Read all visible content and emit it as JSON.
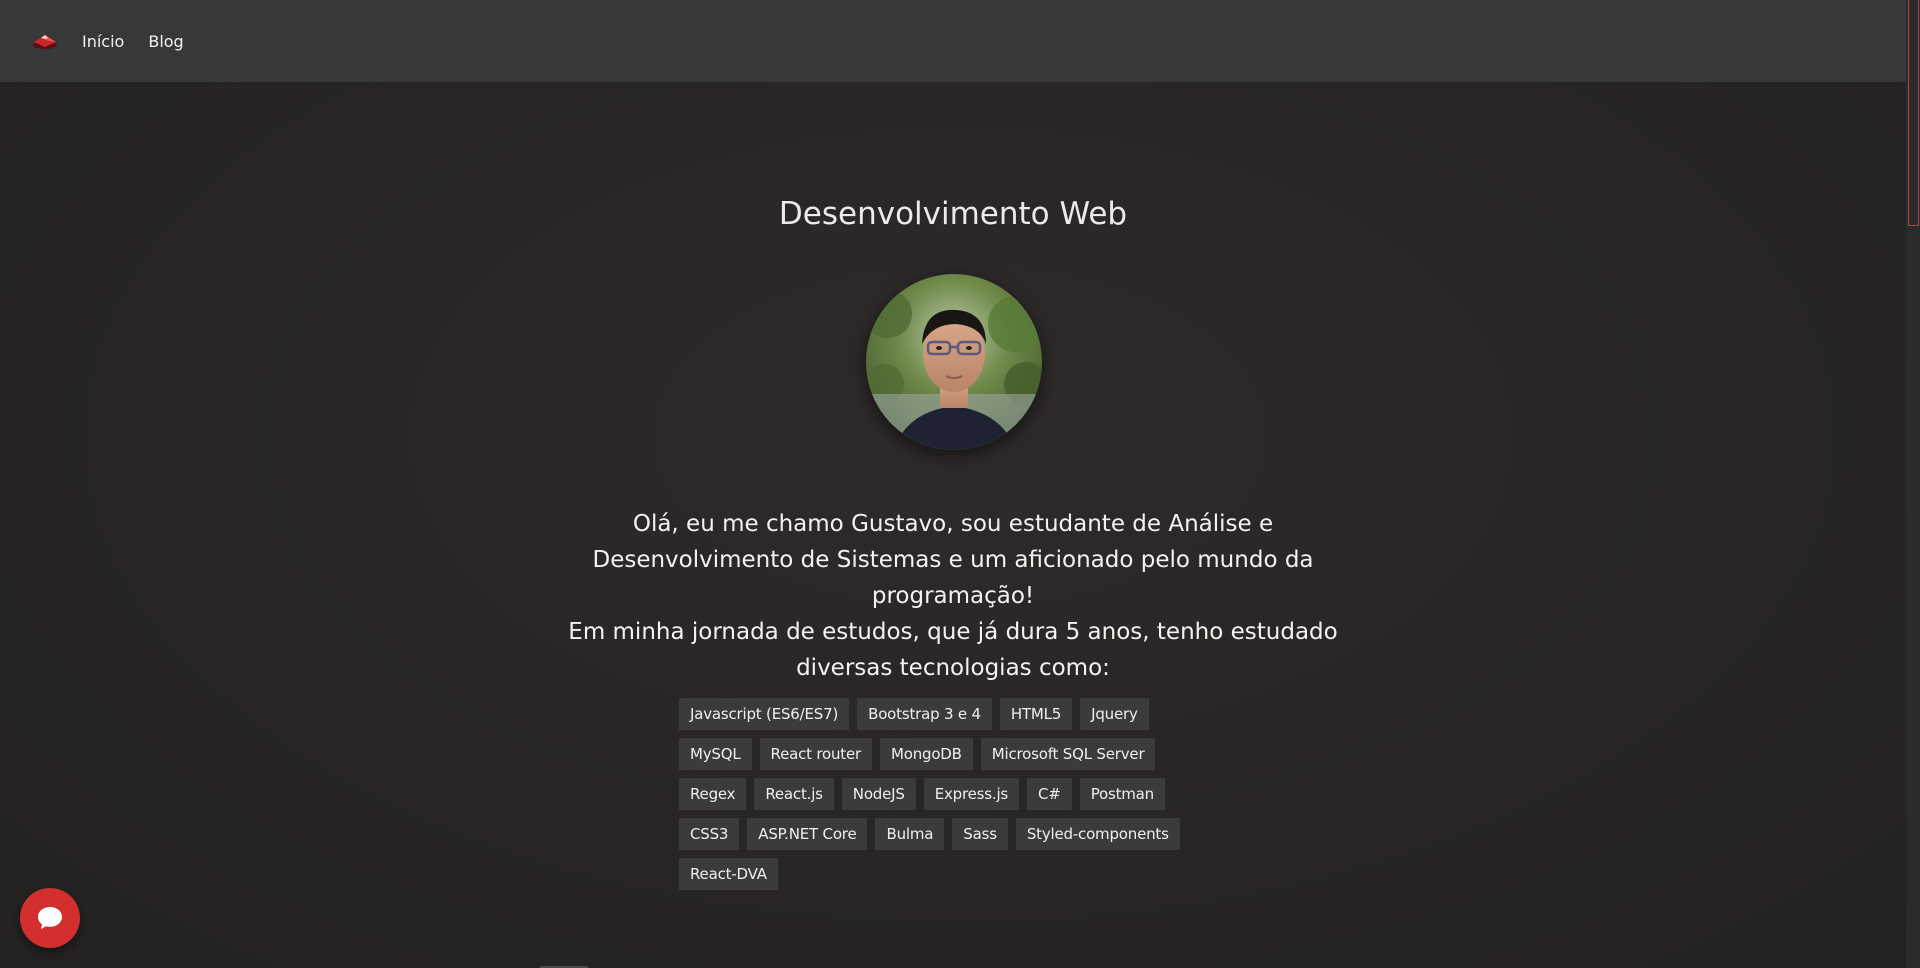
{
  "nav": {
    "logo_icon": "red-gem-logo-icon",
    "links": [
      {
        "label": "Início"
      },
      {
        "label": "Blog"
      }
    ]
  },
  "main": {
    "title": "Desenvolvimento Web",
    "avatar_alt": "profile-photo",
    "intro_line1": "Olá, eu me chamo Gustavo, sou estudante de Análise e Desenvolvimento de Sistemas e um aficionado pelo mundo da programação!",
    "intro_line2": "Em minha jornada de estudos, que já dura 5 anos, tenho estudado diversas tecnologias como:",
    "tags": [
      "Javascript (ES6/ES7)",
      "Bootstrap 3 e 4",
      "HTML5",
      "Jquery",
      "MySQL",
      "React router",
      "MongoDB",
      "Microsoft SQL Server",
      "Regex",
      "React.js",
      "NodeJS",
      "Express.js",
      "C#",
      "Postman",
      "CSS3",
      "ASP.NET Core",
      "Bulma",
      "Sass",
      "Styled-components",
      "React-DVA"
    ]
  },
  "chat": {
    "icon": "chat-bubble-icon"
  },
  "colors": {
    "navbar": "#383838",
    "background": "#282625",
    "tag_bg": "#3b3b3b",
    "chat_button": "#d32f2f"
  }
}
